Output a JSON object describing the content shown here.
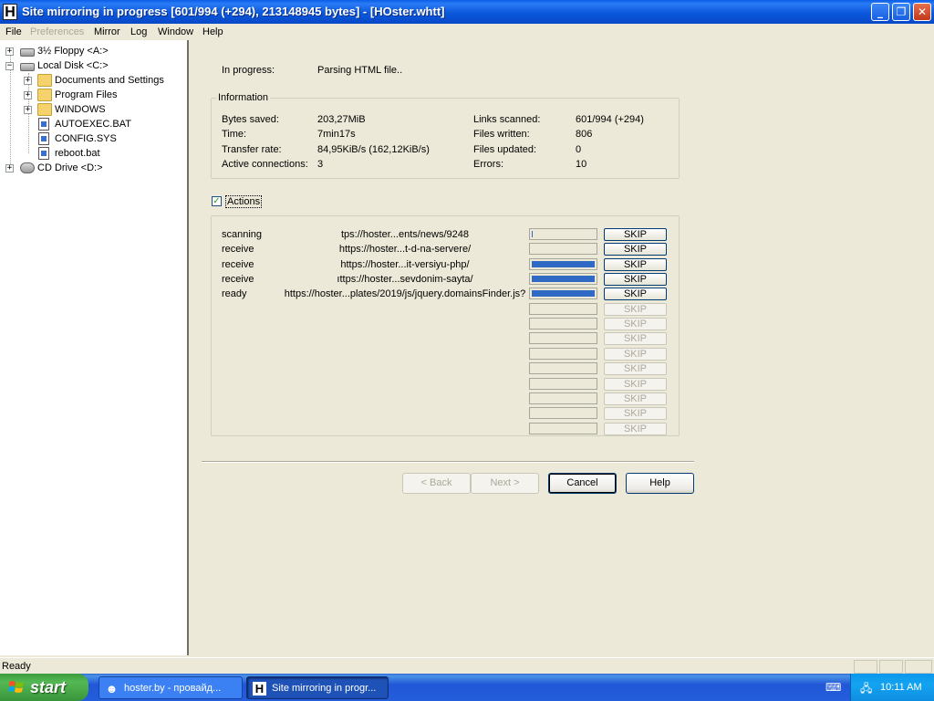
{
  "window": {
    "title": "Site mirroring in progress [601/994 (+294), 213148945 bytes] - [HOster.whtt]",
    "app_icon": "H"
  },
  "menu": [
    "File",
    "Preferences",
    "Mirror",
    "Log",
    "Window",
    "Help"
  ],
  "menu_disabled": [
    "Preferences"
  ],
  "tree": {
    "items": [
      {
        "label": "3½ Floppy <A:>",
        "icon": "floppy-drive-icon"
      },
      {
        "label": "Local Disk <C:>",
        "icon": "hard-drive-icon"
      },
      {
        "label": "Documents and Settings",
        "icon": "folder-icon"
      },
      {
        "label": "Program Files",
        "icon": "folder-icon"
      },
      {
        "label": "WINDOWS",
        "icon": "folder-icon"
      },
      {
        "label": "AUTOEXEC.BAT",
        "icon": "bat-file-icon"
      },
      {
        "label": "CONFIG.SYS",
        "icon": "sys-file-icon"
      },
      {
        "label": "reboot.bat",
        "icon": "bat-file-icon"
      },
      {
        "label": "CD Drive <D:>",
        "icon": "cd-drive-icon"
      }
    ]
  },
  "progress": {
    "in_progress_label": "In progress:",
    "in_progress_value": "Parsing HTML file.."
  },
  "information": {
    "title": "Information",
    "left": [
      {
        "label": "Bytes saved:",
        "value": "203,27MiB"
      },
      {
        "label": "Time:",
        "value": "7min17s"
      },
      {
        "label": "Transfer rate:",
        "value": "84,95KiB/s (162,12KiB/s)"
      },
      {
        "label": "Active connections:",
        "value": "3"
      }
    ],
    "right": [
      {
        "label": "Links scanned:",
        "value": "601/994 (+294)"
      },
      {
        "label": "Files written:",
        "value": "806"
      },
      {
        "label": "Files updated:",
        "value": "0"
      },
      {
        "label": "Errors:",
        "value": "10"
      }
    ]
  },
  "actions": {
    "checkbox_label": "Actions",
    "checked": true,
    "skip_label": "SKIP",
    "rows": [
      {
        "status": "scanning",
        "url": "tps://hoster...ents/news/9248",
        "progress": 0.02
      },
      {
        "status": "receive",
        "url": "https://hoster...t-d-na-servere/",
        "progress": 0
      },
      {
        "status": "receive",
        "url": "https://hoster...it-versiyu-php/",
        "progress": 1
      },
      {
        "status": "receive",
        "url": "ıttps://hoster...sevdonim-sayta/",
        "progress": 1
      },
      {
        "status": "ready",
        "url": "https://hoster...plates/2019/js/jquery.domainsFinder.js?",
        "progress": 1
      },
      {
        "status": "",
        "url": "",
        "progress": 0
      },
      {
        "status": "",
        "url": "",
        "progress": 0
      },
      {
        "status": "",
        "url": "",
        "progress": 0
      },
      {
        "status": "",
        "url": "",
        "progress": 0
      },
      {
        "status": "",
        "url": "",
        "progress": 0
      },
      {
        "status": "",
        "url": "",
        "progress": 0
      },
      {
        "status": "",
        "url": "",
        "progress": 0
      },
      {
        "status": "",
        "url": "",
        "progress": 0
      },
      {
        "status": "",
        "url": "",
        "progress": 0
      }
    ]
  },
  "buttons": {
    "back": "< Back",
    "next": "Next >",
    "cancel": "Cancel",
    "help": "Help"
  },
  "status_bar": {
    "text": "Ready"
  },
  "taskbar": {
    "start": "start",
    "tasks": [
      {
        "label": "hoster.by - провайд...",
        "icon": "browser-icon",
        "active": false
      },
      {
        "label": "Site mirroring in progr...",
        "icon": "httrack-icon",
        "active": true
      }
    ],
    "clock": "10:11 AM"
  },
  "colors": {
    "progress_fill": "#316ac5",
    "title_blue": "#0a5ee8"
  }
}
